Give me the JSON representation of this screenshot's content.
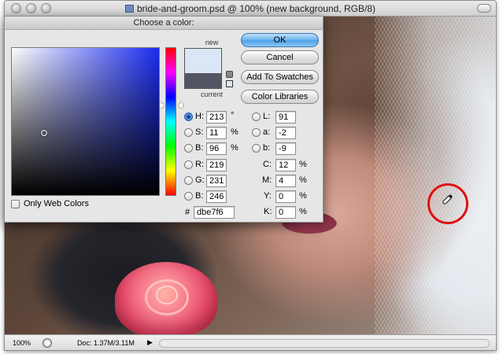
{
  "document": {
    "title": "bride-and-groom.psd @ 100% (new background, RGB/8)",
    "status_zoom": "100%",
    "status_doc": "Doc: 1.37M/3.11M"
  },
  "dialog": {
    "title": "Choose a color:",
    "new_label": "new",
    "current_label": "current",
    "new_color": "#dbe7f6",
    "current_color": "#545562",
    "buttons": {
      "ok": "OK",
      "cancel": "Cancel",
      "add_to_swatches": "Add To Swatches",
      "color_libraries": "Color Libraries"
    },
    "hsb": [
      {
        "label": "H:",
        "value": "213",
        "unit": "°",
        "selected": true
      },
      {
        "label": "S:",
        "value": "11",
        "unit": "%",
        "selected": false
      },
      {
        "label": "B:",
        "value": "96",
        "unit": "%",
        "selected": false
      }
    ],
    "rgb": [
      {
        "label": "R:",
        "value": "219"
      },
      {
        "label": "G:",
        "value": "231"
      },
      {
        "label": "B:",
        "value": "246"
      }
    ],
    "lab": [
      {
        "label": "L:",
        "value": "91"
      },
      {
        "label": "a:",
        "value": "-2"
      },
      {
        "label": "b:",
        "value": "-9"
      }
    ],
    "cmyk": [
      {
        "label": "C:",
        "value": "12",
        "unit": "%"
      },
      {
        "label": "M:",
        "value": "4",
        "unit": "%"
      },
      {
        "label": "Y:",
        "value": "0",
        "unit": "%"
      },
      {
        "label": "K:",
        "value": "0",
        "unit": "%"
      }
    ],
    "hex_label": "#",
    "hex_value": "dbe7f6",
    "only_web_colors_label": "Only Web Colors",
    "only_web_colors_checked": false
  },
  "colors": {
    "sample_circle": "#e0100f",
    "ok_button_accent": "#4d9fe6"
  },
  "icons": {
    "eyedropper": "eyedropper-icon",
    "gamut_warning": "gamut-warning-icon"
  }
}
